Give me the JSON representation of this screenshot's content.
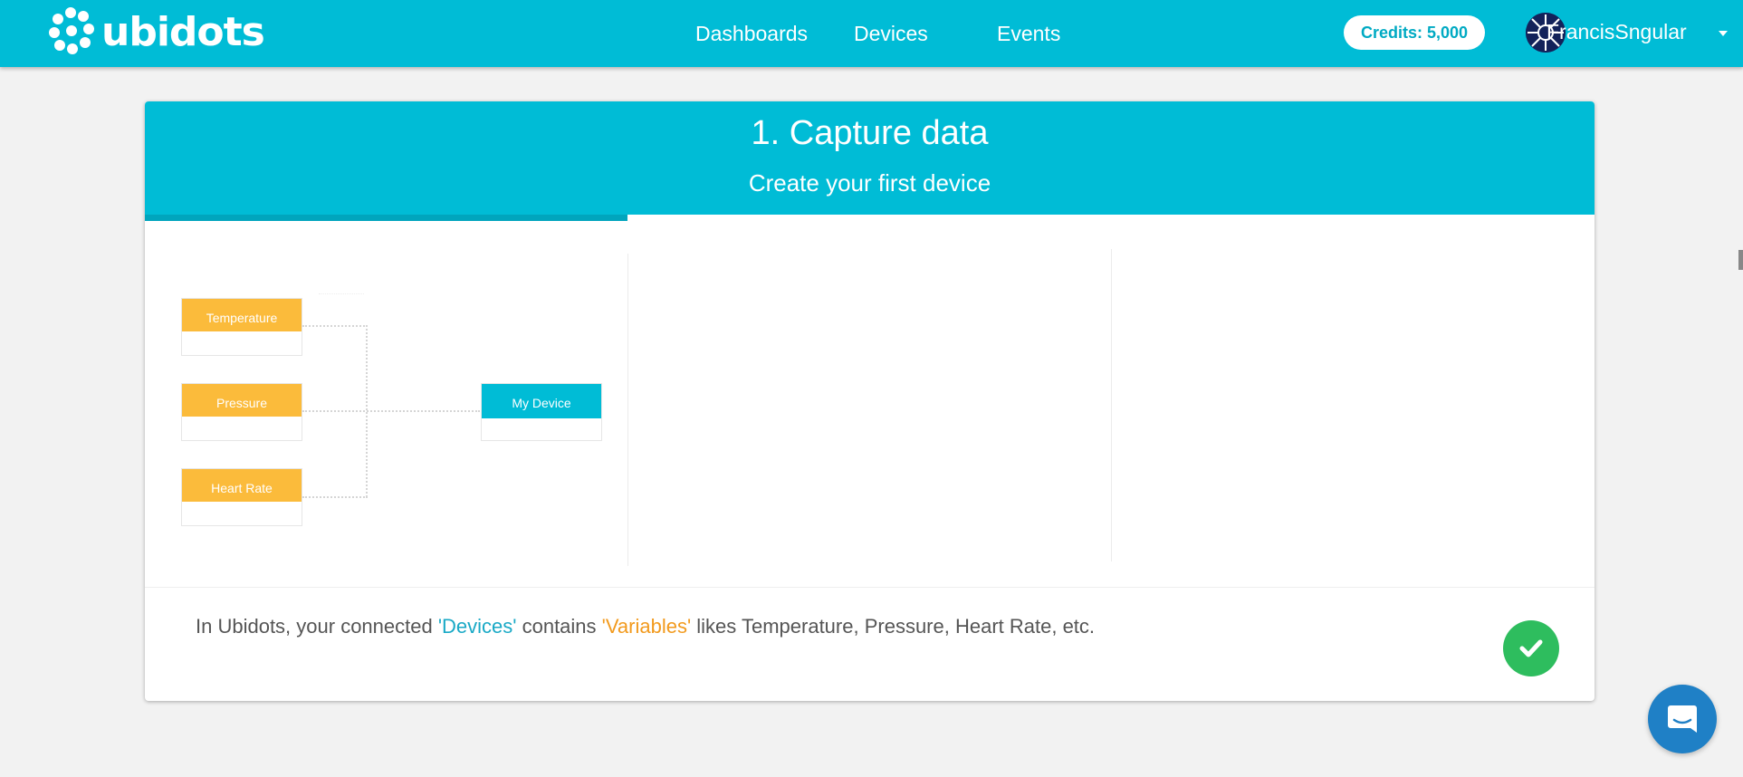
{
  "brand": {
    "name": "ubidots"
  },
  "nav": {
    "links": [
      "Dashboards",
      "Devices",
      "Events"
    ]
  },
  "account": {
    "credits_label": "Credits: 5,000",
    "username": "FrancisSngular"
  },
  "card": {
    "title": "1. Capture data",
    "subtitle": "Create your first device",
    "progress_fraction": 0.333,
    "diagram": {
      "variables": [
        "Temperature",
        "Pressure",
        "Heart Rate"
      ],
      "device": "My Device"
    },
    "footer": {
      "prefix": "In Ubidots, your connected ",
      "devices_term": "'Devices'",
      "middle": " contains ",
      "variables_term": "'Variables'",
      "suffix": " likes Temperature, Pressure, Heart Rate, etc."
    }
  },
  "colors": {
    "brand": "#00bcd6",
    "variable_box": "#fbbb3b",
    "confirm": "#2ebd5e",
    "chat": "#1f80c6"
  },
  "icons": [
    "check-icon",
    "chat-icon",
    "caret-down-icon"
  ]
}
